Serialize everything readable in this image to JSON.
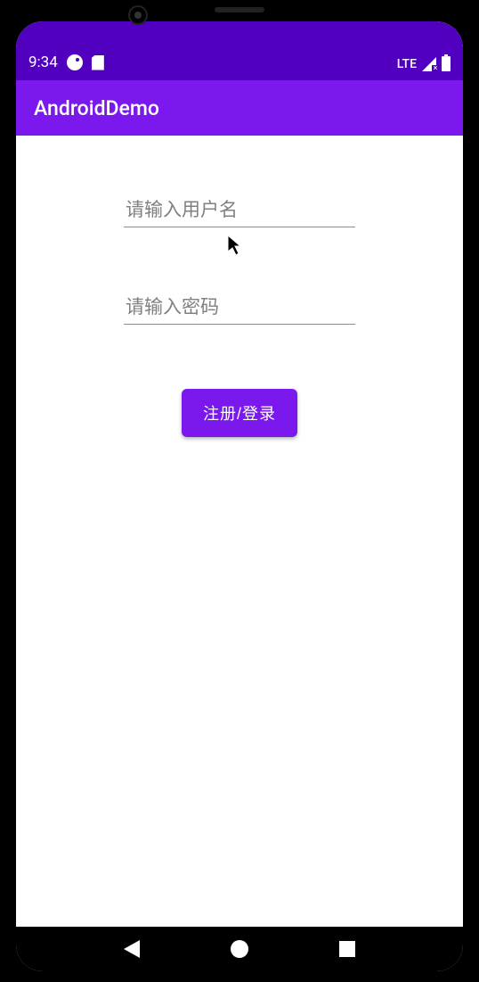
{
  "status_bar": {
    "time": "9:34",
    "lte_label": "LTE"
  },
  "app_bar": {
    "title": "AndroidDemo"
  },
  "form": {
    "username_placeholder": "请输入用户名",
    "password_placeholder": "请输入密码",
    "submit_label": "注册/登录"
  },
  "colors": {
    "status_bar_bg": "#5100bf",
    "app_bar_bg": "#7b18ed",
    "button_bg": "#7b18ed"
  }
}
